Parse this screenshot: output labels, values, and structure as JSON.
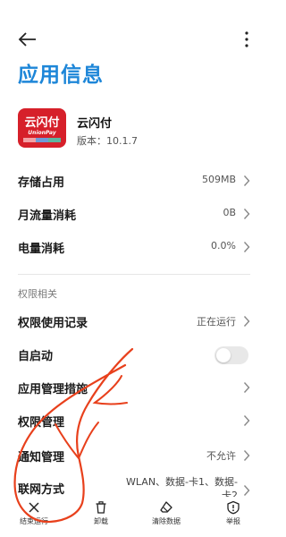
{
  "header": {
    "back_icon": "back-arrow-icon",
    "more_icon": "more-vertical-icon",
    "title": "应用信息"
  },
  "app": {
    "icon_text": "云闪付",
    "icon_subtext": "UnionPay",
    "name": "云闪付",
    "version": "版本：10.1.7",
    "brand_colors": [
      "#d6202a",
      "#1b5aa8",
      "#14866d"
    ]
  },
  "info_rows": [
    {
      "label": "存储占用",
      "value": "509MB"
    },
    {
      "label": "月流量消耗",
      "value": "0B"
    },
    {
      "label": "电量消耗",
      "value": "0.0%"
    }
  ],
  "permissions": {
    "section_title": "权限相关",
    "usage_record": {
      "label": "权限使用记录",
      "value": "正在运行"
    },
    "autostart": {
      "label": "自启动",
      "enabled": false
    },
    "app_management": {
      "label": "应用管理措施"
    },
    "permission_management": {
      "label": "权限管理"
    },
    "notification_management": {
      "label": "通知管理",
      "value": "不允许"
    },
    "network": {
      "label": "联网方式",
      "value": "WLAN、数据-卡1、数据-卡2"
    }
  },
  "bottom_bar": [
    {
      "label": "结束运行",
      "icon": "close-icon"
    },
    {
      "label": "卸载",
      "icon": "trash-icon"
    },
    {
      "label": "清除数据",
      "icon": "eraser-icon"
    },
    {
      "label": "举报",
      "icon": "report-icon"
    }
  ],
  "colors": {
    "accent": "#1d86d8",
    "annotation": "#e8401c"
  }
}
